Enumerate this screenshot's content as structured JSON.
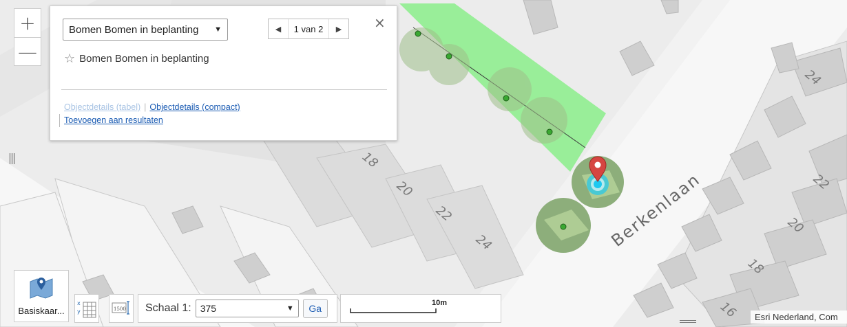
{
  "map": {
    "house_numbers_left": [
      "18",
      "20",
      "22",
      "24"
    ],
    "house_numbers_right": [
      "24",
      "22",
      "20",
      "18",
      "16"
    ],
    "street_name": "Berkenlaan",
    "colors": {
      "selection_fill": "#90ee90",
      "tree_dot": "#3aa832",
      "marker": "#d64541",
      "highlight": "#1ec8f0"
    }
  },
  "zoom": {
    "in_label": "+",
    "out_label": "—"
  },
  "popup": {
    "layer_select_value": "Bomen Bomen in beplanting",
    "pager_label": "1 van 2",
    "close_label": "×",
    "feature_title": "Bomen Bomen in beplanting",
    "star_icon": "☆",
    "link_table": "Objectdetails (tabel)",
    "link_compact": "Objectdetails (compact)",
    "link_add": "Toevoegen aan resultaten"
  },
  "toolbar": {
    "basemap_label": "Basiskaar...",
    "scale_label": "Schaal 1:",
    "scale_value": "375",
    "go_label": "Ga",
    "scalebar_label": "10m",
    "scale_icon_text": "1500"
  },
  "attribution": "Esri Nederland, Com"
}
